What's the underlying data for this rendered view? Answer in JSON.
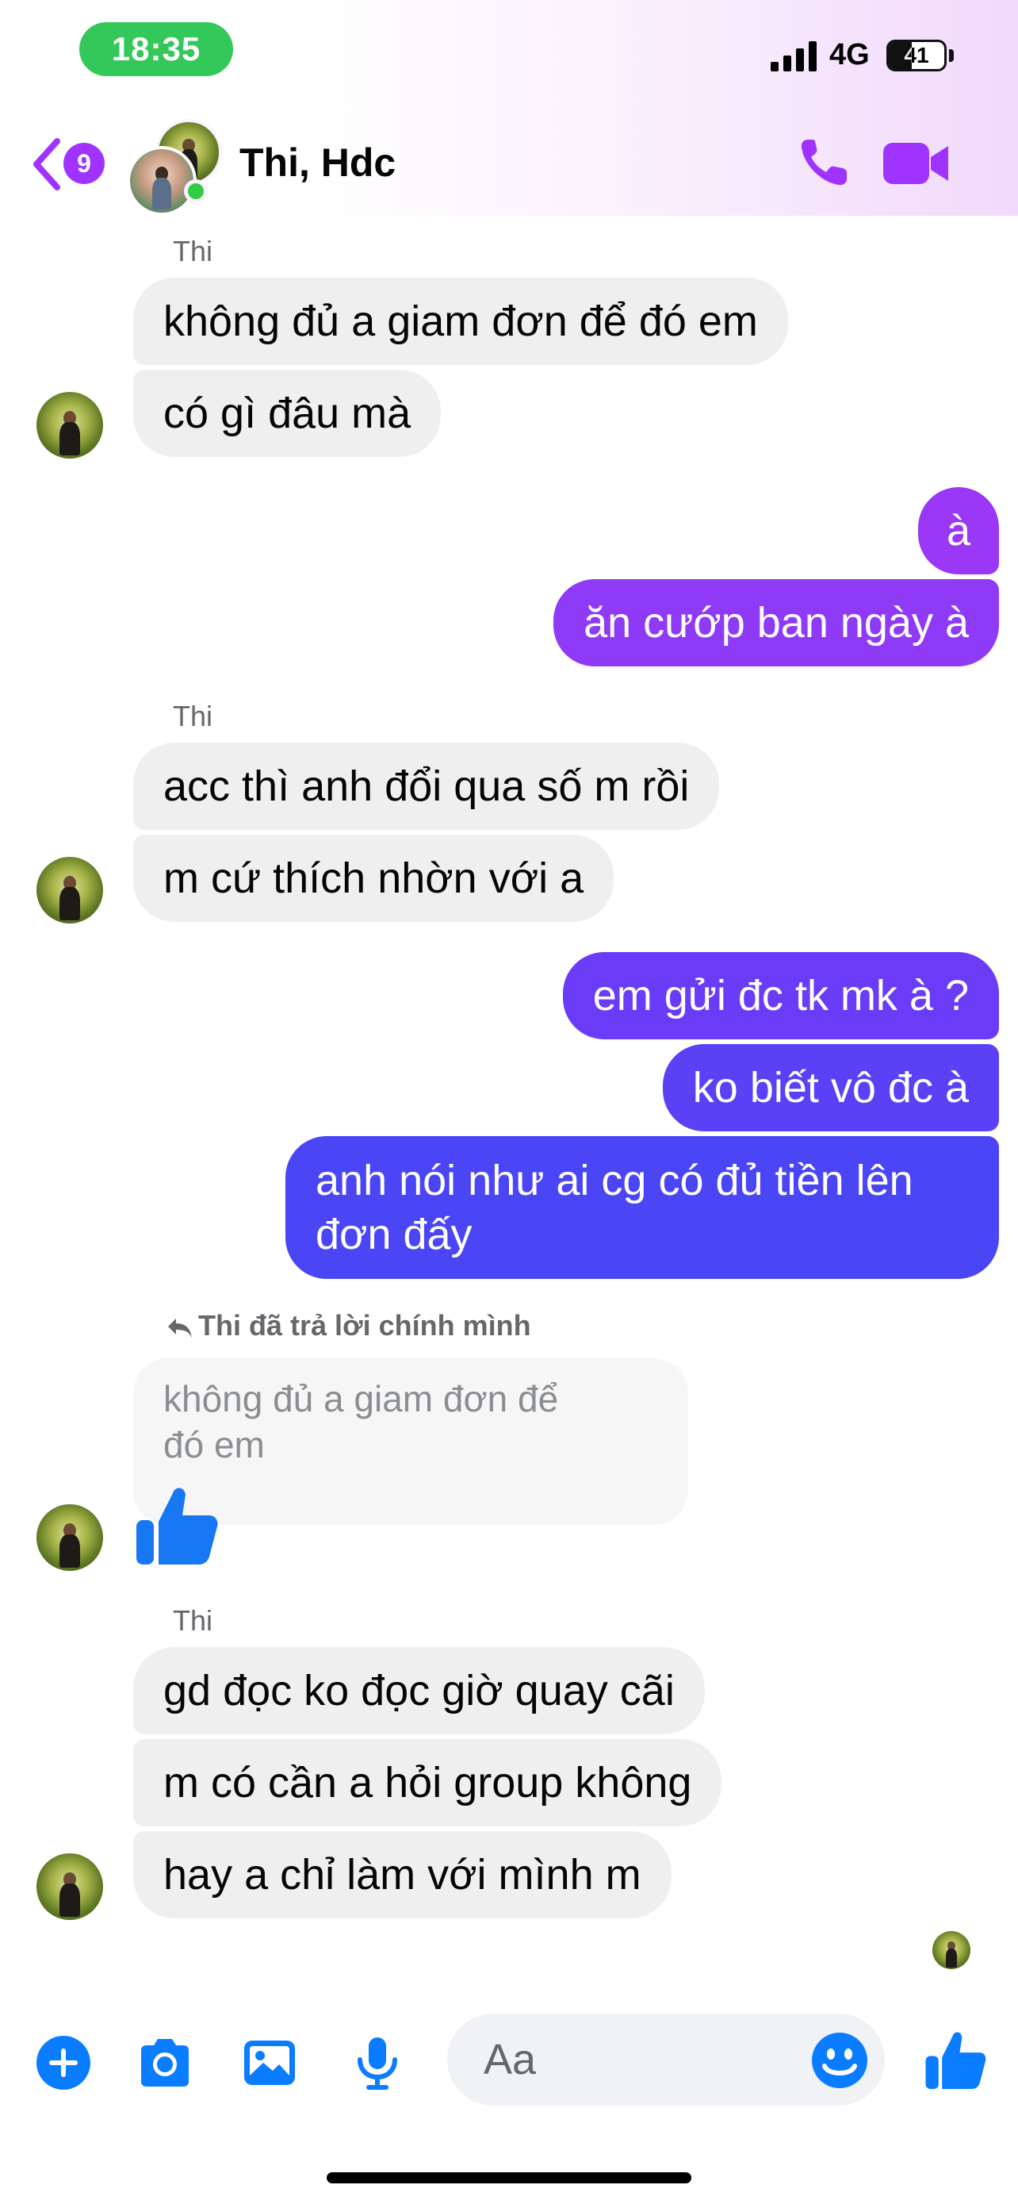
{
  "status_bar": {
    "time": "18:35",
    "network": "4G",
    "battery": "41",
    "battery_level": 0.41,
    "accent": "#34c759"
  },
  "header": {
    "back_badge": "9",
    "title": "Thi, Hdc",
    "online_color": "#31cc46",
    "icon_color": "#a033ff"
  },
  "messages": {
    "group1": {
      "sender": "Thi",
      "lines": [
        "không đủ a giam đơn để đó em",
        "có gì đâu mà"
      ]
    },
    "out1": [
      "à",
      "ăn cướp ban ngày à"
    ],
    "group2": {
      "sender": "Thi",
      "lines": [
        "acc thì anh đổi qua số m rồi",
        "m cứ thích nhờn với a"
      ]
    },
    "out2": {
      "lines": [
        "em gửi đc tk mk à ?",
        "ko biết vô đc à"
      ],
      "long_line1": "anh nói như ai cg có đủ tiền lên",
      "long_line2": "đơn đấy"
    },
    "reply": {
      "note": "Thi đã trả lời chính mình",
      "quoted_line1": "không đủ a giam đơn để",
      "quoted_line2": "đó em"
    },
    "group3": {
      "sender": "Thi",
      "lines": [
        "gd đọc ko đọc giờ quay cãi",
        "m có cần a hỏi group không",
        "hay a chỉ làm với mình m"
      ]
    }
  },
  "composer": {
    "placeholder": "Aa",
    "icons": [
      "plus-icon",
      "camera-icon",
      "image-icon",
      "microphone-icon",
      "emoji-icon",
      "thumbs-up-icon"
    ],
    "icon_color": "#0a7cff"
  },
  "colors": {
    "incoming_bubble": "#efefef",
    "outgoing_top": "#9b37f7",
    "outgoing_mid": "#6a3cf7",
    "outgoing_bottom": "#4a45f5"
  }
}
